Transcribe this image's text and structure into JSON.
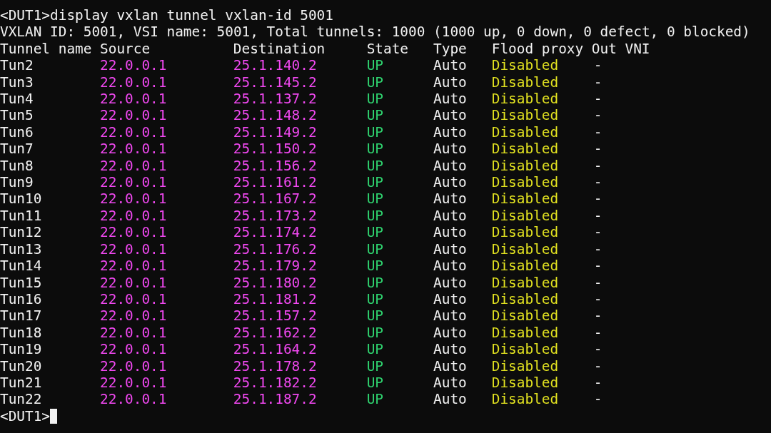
{
  "command_line": "<DUT1>display vxlan tunnel vxlan-id 5001",
  "summary": "VXLAN ID: 5001, VSI name: 5001, Total tunnels: 1000 (1000 up, 0 down, 0 defect, 0 blocked)",
  "columns": [
    "Tunnel name",
    "Source",
    "Destination",
    "State",
    "Type",
    "Flood proxy",
    "Out VNI"
  ],
  "rows": [
    [
      "Tun2",
      "22.0.0.1",
      "25.1.140.2",
      "UP",
      "Auto",
      "Disabled",
      "-"
    ],
    [
      "Tun3",
      "22.0.0.1",
      "25.1.145.2",
      "UP",
      "Auto",
      "Disabled",
      "-"
    ],
    [
      "Tun4",
      "22.0.0.1",
      "25.1.137.2",
      "UP",
      "Auto",
      "Disabled",
      "-"
    ],
    [
      "Tun5",
      "22.0.0.1",
      "25.1.148.2",
      "UP",
      "Auto",
      "Disabled",
      "-"
    ],
    [
      "Tun6",
      "22.0.0.1",
      "25.1.149.2",
      "UP",
      "Auto",
      "Disabled",
      "-"
    ],
    [
      "Tun7",
      "22.0.0.1",
      "25.1.150.2",
      "UP",
      "Auto",
      "Disabled",
      "-"
    ],
    [
      "Tun8",
      "22.0.0.1",
      "25.1.156.2",
      "UP",
      "Auto",
      "Disabled",
      "-"
    ],
    [
      "Tun9",
      "22.0.0.1",
      "25.1.161.2",
      "UP",
      "Auto",
      "Disabled",
      "-"
    ],
    [
      "Tun10",
      "22.0.0.1",
      "25.1.167.2",
      "UP",
      "Auto",
      "Disabled",
      "-"
    ],
    [
      "Tun11",
      "22.0.0.1",
      "25.1.173.2",
      "UP",
      "Auto",
      "Disabled",
      "-"
    ],
    [
      "Tun12",
      "22.0.0.1",
      "25.1.174.2",
      "UP",
      "Auto",
      "Disabled",
      "-"
    ],
    [
      "Tun13",
      "22.0.0.1",
      "25.1.176.2",
      "UP",
      "Auto",
      "Disabled",
      "-"
    ],
    [
      "Tun14",
      "22.0.0.1",
      "25.1.179.2",
      "UP",
      "Auto",
      "Disabled",
      "-"
    ],
    [
      "Tun15",
      "22.0.0.1",
      "25.1.180.2",
      "UP",
      "Auto",
      "Disabled",
      "-"
    ],
    [
      "Tun16",
      "22.0.0.1",
      "25.1.181.2",
      "UP",
      "Auto",
      "Disabled",
      "-"
    ],
    [
      "Tun17",
      "22.0.0.1",
      "25.1.157.2",
      "UP",
      "Auto",
      "Disabled",
      "-"
    ],
    [
      "Tun18",
      "22.0.0.1",
      "25.1.162.2",
      "UP",
      "Auto",
      "Disabled",
      "-"
    ],
    [
      "Tun19",
      "22.0.0.1",
      "25.1.164.2",
      "UP",
      "Auto",
      "Disabled",
      "-"
    ],
    [
      "Tun20",
      "22.0.0.1",
      "25.1.178.2",
      "UP",
      "Auto",
      "Disabled",
      "-"
    ],
    [
      "Tun21",
      "22.0.0.1",
      "25.1.182.2",
      "UP",
      "Auto",
      "Disabled",
      "-"
    ],
    [
      "Tun22",
      "22.0.0.1",
      "25.1.187.2",
      "UP",
      "Auto",
      "Disabled",
      "-"
    ]
  ],
  "prompt": "<DUT1>"
}
